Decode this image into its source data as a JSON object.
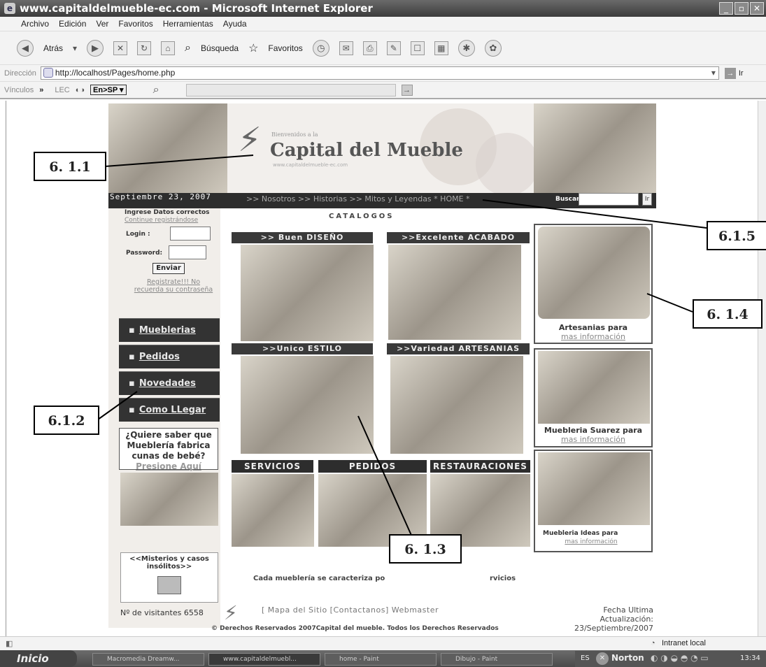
{
  "window": {
    "title": "www.capitaldelmueble-ec.com - Microsoft Internet Explorer"
  },
  "menu": [
    "Archivo",
    "Edición",
    "Ver",
    "Favoritos",
    "Herramientas",
    "Ayuda"
  ],
  "toolbar": {
    "back": "Atrás",
    "search": "Búsqueda",
    "favorites": "Favoritos"
  },
  "address": {
    "label": "Dirección",
    "url": "http://localhost/Pages/home.php",
    "go": "Ir"
  },
  "links_bar": {
    "label": "Vínculos",
    "lec": "LEC",
    "translate": "En>SP"
  },
  "site": {
    "banner_small": "Bienvenidos a la",
    "banner_title": "Capital del Mueble",
    "banner_url": "www.capitaldelmueble-ec.com",
    "date": "Septiembre   23, 2007",
    "nav": [
      ">> Nosotros",
      ">> Historias",
      ">> Mitos y Leyendas",
      "* HOME *"
    ],
    "buscar": "Buscar:",
    "ir": "Ir",
    "login_intro": "Ingrese Datos correctos",
    "continue_reg": "Continue registrándose",
    "login_label": "Login :",
    "password_label": "Password:",
    "enviar": "Enviar",
    "register_text": "Registrate!!!   No recuerda su contraseña",
    "left_menu": [
      "Mueblerias",
      "Pedidos",
      "Novedades",
      "Como LLegar"
    ],
    "cunas_q": "¿Quiere saber que Mueblería fabrica cunas de bebé?",
    "cunas_link": "Presione Aquí",
    "misterios": "<<Misterios y casos insólitos>>",
    "visits": "Nº de visitantes 6558",
    "catalogos": "CATALOGOS",
    "cat_heads": [
      ">> Buen DISEÑO",
      ">>Excelente ACABADO",
      ">>Unico ESTILO",
      ">>Variedad ARTESANIAS"
    ],
    "services": [
      "SERVICIOS",
      "PEDIDOS",
      "RESTAURACIONES"
    ],
    "cada": "Cada mueblería se caracteriza po",
    "cada_tail": "rvicios",
    "footer_links": "[ Mapa del Sitio  [Contactanos] Webmaster",
    "fecha": "Fecha Ultima Actualización: 23/Septiembre/2007",
    "derechos": "© Derechos Reservados 2007Capital del mueble. Todos los Derechos Reservados",
    "right": [
      {
        "title": "Artesanias para",
        "link": "mas información"
      },
      {
        "title": "Muebleria Suarez para",
        "link": "mas información"
      },
      {
        "title": "Muebleria Ideas para",
        "link": "mas información"
      }
    ]
  },
  "annotations": [
    "6. 1.1",
    "6.1.5",
    "6. 1.4",
    "6.1.2",
    "6. 1.3"
  ],
  "status": {
    "zone": "Intranet local"
  },
  "taskbar": {
    "start": "Inicio",
    "tasks": [
      "Macromedia Dreamw...",
      "www.capitaldelmuebl...",
      "home - Paint",
      "Dibujo - Paint"
    ],
    "tray_lang": "ES",
    "norton": "Norton",
    "clock": "13:34"
  }
}
